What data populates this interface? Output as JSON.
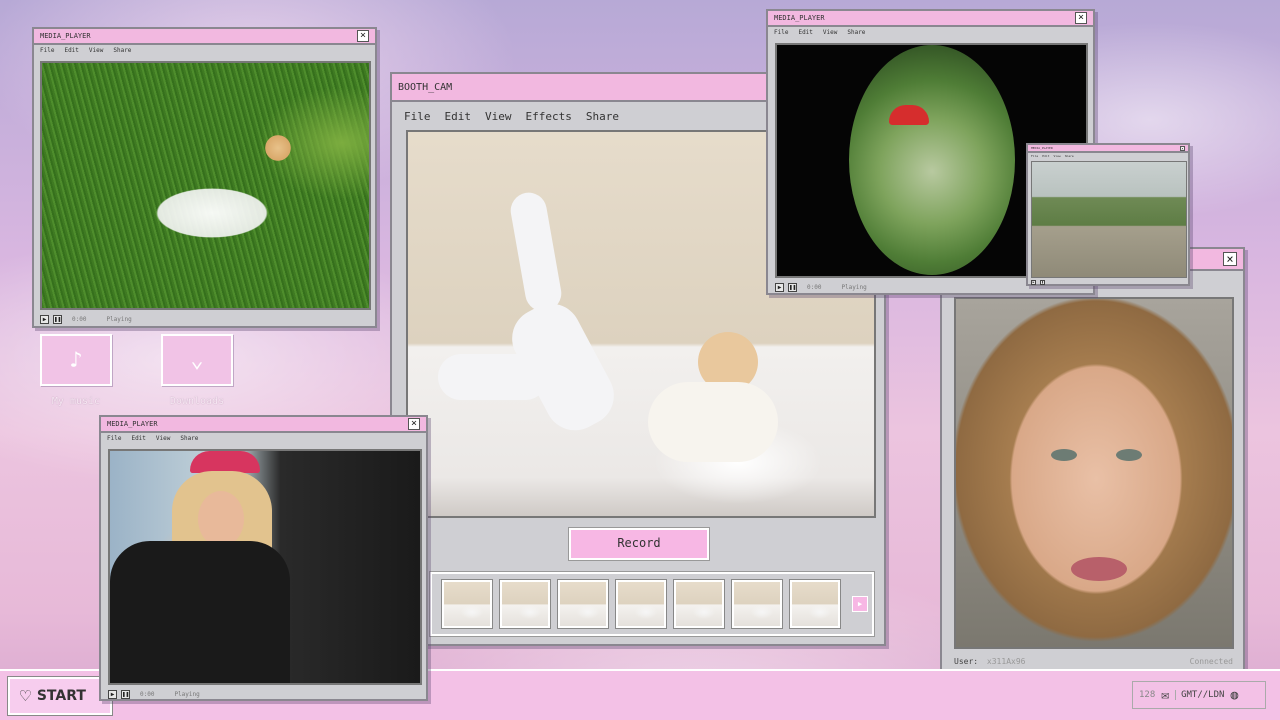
{
  "desktop": {
    "icons": [
      {
        "label": "My music",
        "glyph": "♪",
        "icon_name": "music-note-icon"
      },
      {
        "label": "Downloads",
        "glyph": "⌄",
        "icon_name": "download-arrow-icon"
      }
    ]
  },
  "player_grass": {
    "title": "MEDIA_PLAYER",
    "menu": [
      "File",
      "Edit",
      "View",
      "Share"
    ],
    "time": "0:00",
    "status": "Playing"
  },
  "booth_cam": {
    "title": "BOOTH_CAM",
    "menu": [
      "File",
      "Edit",
      "View",
      "Effects",
      "Share"
    ],
    "record_label": "Record",
    "next_glyph": "▸"
  },
  "player_fisheye": {
    "title": "MEDIA_PLAYER",
    "menu": [
      "File",
      "Edit",
      "View",
      "Share"
    ],
    "time": "0:00",
    "status": "Playing"
  },
  "player_road": {
    "title": "MEDIA_PLAYER",
    "menu": [
      "File",
      "Edit",
      "View",
      "Share"
    ]
  },
  "player_car": {
    "title": "MEDIA_PLAYER",
    "menu": [
      "File",
      "Edit",
      "View",
      "Share"
    ],
    "time": "0:00",
    "status": "Playing"
  },
  "video_call": {
    "user_label": "User:",
    "user_value": "x311Ax96",
    "status": "Connected"
  },
  "taskbar": {
    "start_label": "START",
    "mail_count": "128",
    "clock": "GMT//LDN"
  },
  "colors": {
    "titlebar_pink": "#f2b8e0",
    "window_grey": "#cfcfd3",
    "record_pink": "#f7b7e4"
  }
}
